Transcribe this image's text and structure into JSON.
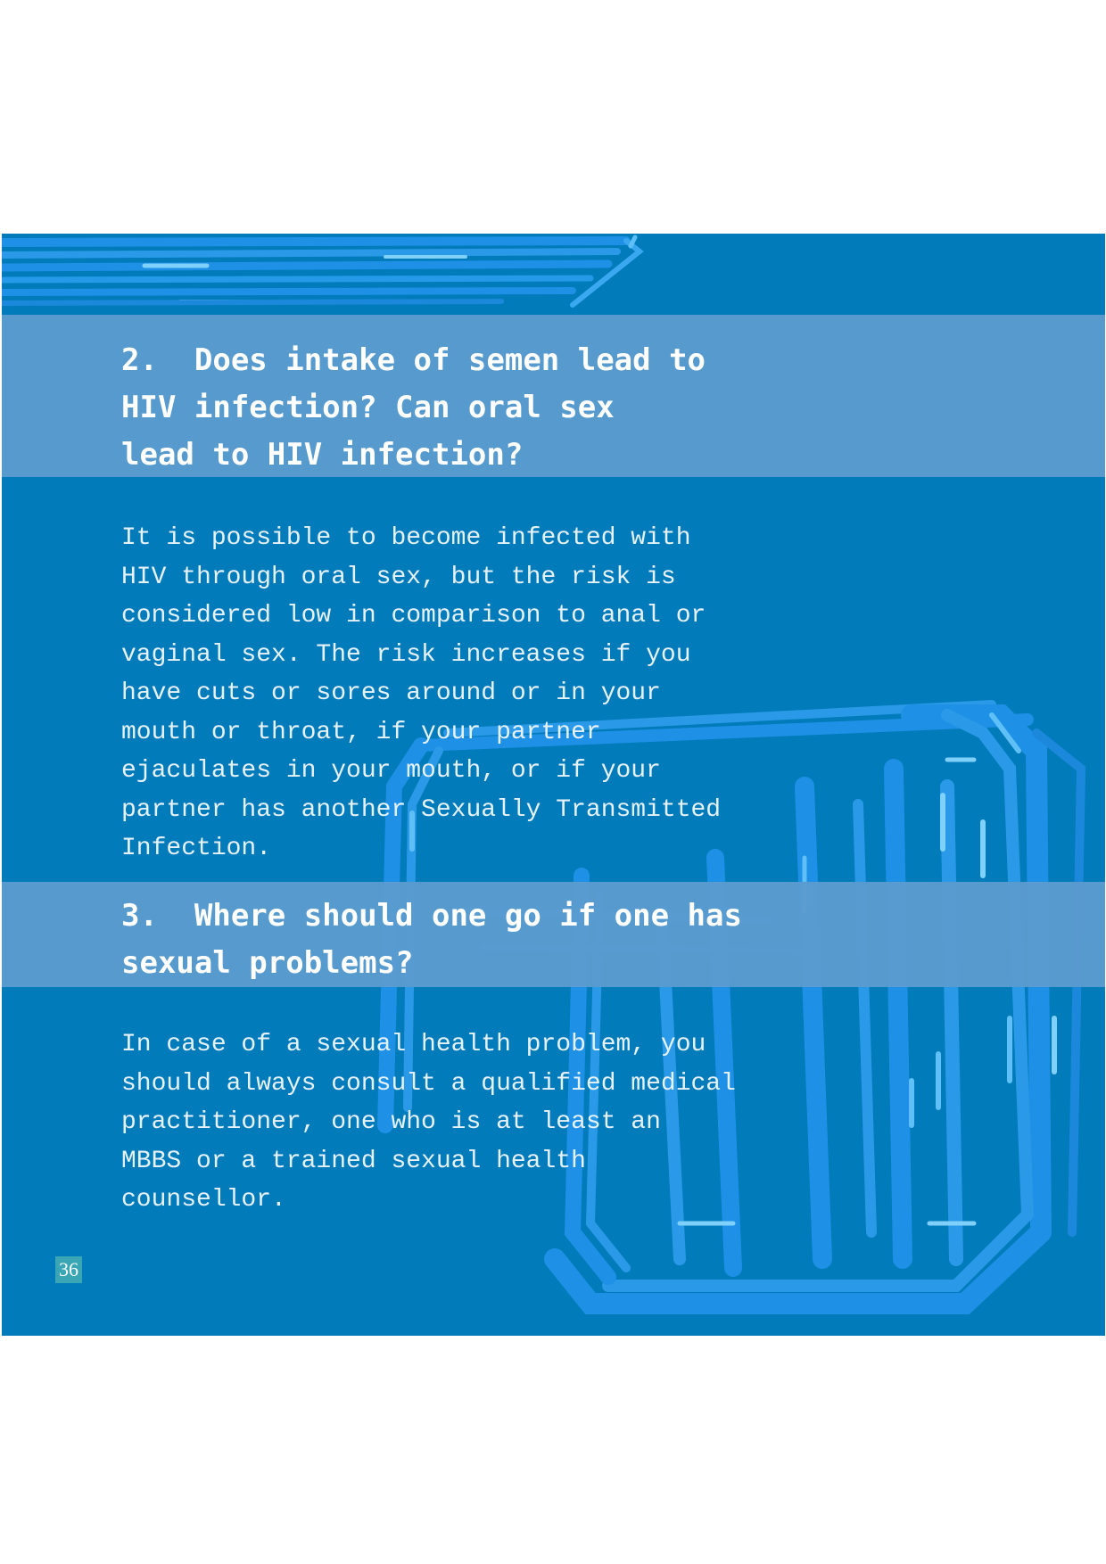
{
  "page_number": "36",
  "colors": {
    "panel_background": "#017bb9",
    "heading_band": "#5b9bcf",
    "decor_stroke": "#1e90e6",
    "page_number_badge": "#3aa6b5"
  },
  "sections": [
    {
      "heading_lines": [
        "2.  Does intake of semen lead to",
        "HIV infection? Can oral sex",
        "lead to HIV infection?"
      ],
      "body_lines": [
        "It is possible to become infected with",
        "HIV through oral sex, but the risk is",
        "considered low in comparison to anal or",
        "vaginal sex. The risk increases if you",
        "have cuts or sores around or in your",
        "mouth or throat, if your partner",
        "ejaculates in your mouth, or if your",
        "partner has another Sexually Transmitted",
        "Infection."
      ]
    },
    {
      "heading_lines": [
        "3.  Where should one go if one has",
        "sexual problems?"
      ],
      "body_lines": [
        "In case of a sexual health problem, you",
        "should always consult a qualified medical",
        "practitioner, one who is at least an",
        "MBBS or a trained sexual health",
        "counsellor."
      ]
    }
  ]
}
